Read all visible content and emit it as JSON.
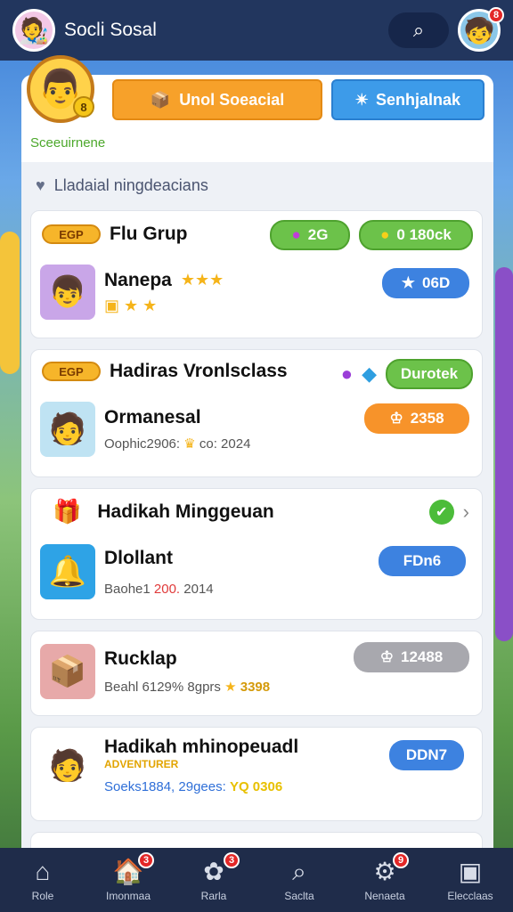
{
  "app": {
    "title": "Socli Sosal"
  },
  "colors": {
    "topbar": "#22365e",
    "accent_orange": "#f7a12a",
    "accent_blue": "#3d9be9",
    "accent_green": "#6cc24a",
    "navbar": "#1f2c4a"
  },
  "header": {
    "profile_sub": "Sceeuirnene",
    "profile_coin": "8",
    "btn_orange": "Unol Soeacial",
    "btn_blue": "Senhjalnak",
    "notif_count": "8"
  },
  "section": {
    "title": "Lladaial ningdeacians"
  },
  "cards": [
    {
      "ticket": "EGP",
      "title": "Flu Grup",
      "pill1": "2G",
      "pill2": "0 180ck",
      "name": "Nanepa",
      "name_stars": "★★★",
      "chip": "06D"
    },
    {
      "ticket": "EGP",
      "title": "Hadiras Vronlsclass",
      "pill": "Durotek",
      "name": "Ormanesal",
      "meta": "Oophic2906:",
      "meta2": "co: 2024",
      "chip": "2358"
    },
    {
      "title": "Hadikah Minggeuan",
      "name": "Dlollant",
      "chip": "FDn6",
      "meta": "Baohe1",
      "meta_red": "200.",
      "meta2": "2014"
    },
    {
      "name": "Rucklap",
      "meta": "Beahl 6129%  8gprs",
      "stars_value": "3398",
      "chip": "12488"
    },
    {
      "title": "Hadikah mhinopeuadl",
      "subtitle": "ADVENTURER",
      "meta": "Soeks1884,  29gees:",
      "meta_yellow": "YQ 0306",
      "chip": "DDN7"
    }
  ],
  "nav": [
    {
      "label": "Role",
      "icon": "home-icon"
    },
    {
      "label": "Imonmaa",
      "icon": "house-icon",
      "badge": "3"
    },
    {
      "label": "Rarla",
      "icon": "paw-icon",
      "badge": "3"
    },
    {
      "label": "Saclta",
      "icon": "search-icon"
    },
    {
      "label": "Nenaeta",
      "icon": "settings-icon",
      "badge": "9"
    },
    {
      "label": "Elecclaas",
      "icon": "frame-icon"
    }
  ]
}
